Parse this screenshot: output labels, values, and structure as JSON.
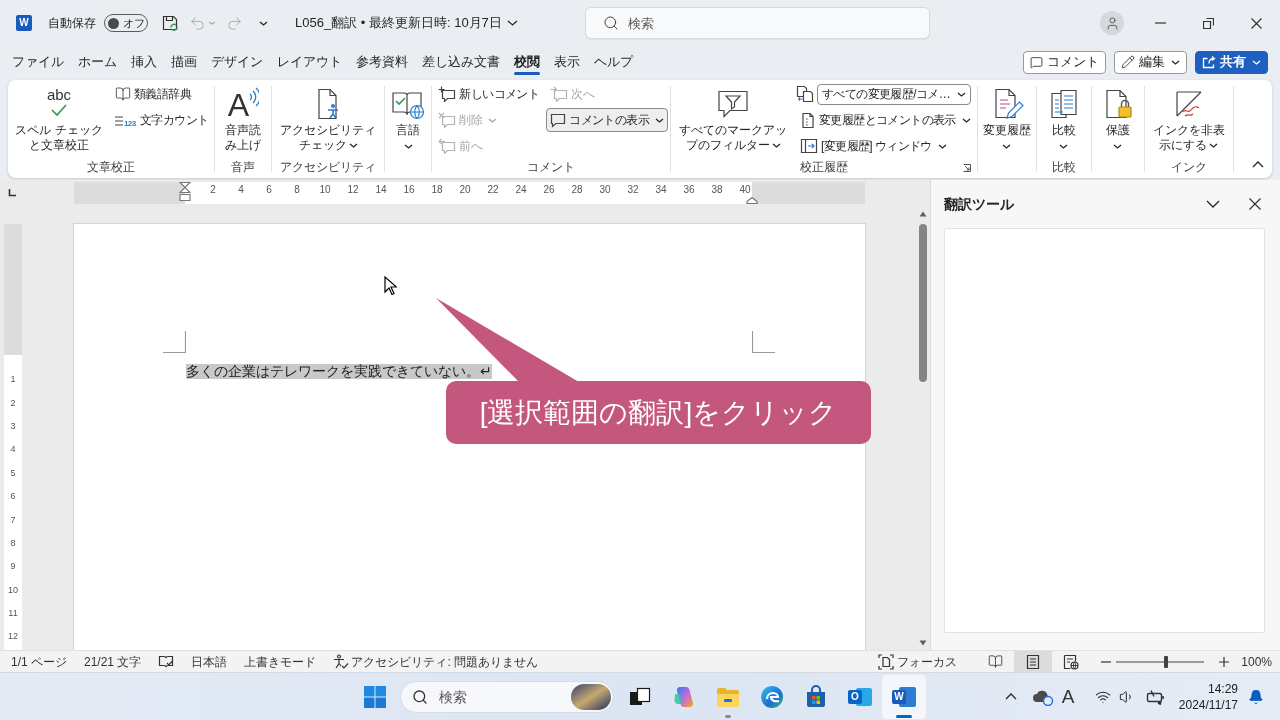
{
  "title_bar": {
    "app_letter": "W",
    "autosave": {
      "label": "自動保存",
      "state_label": "オフ",
      "on": false
    },
    "quick_access": [
      {
        "kind": "save",
        "disabled": false,
        "dropdown": false
      },
      {
        "kind": "undo",
        "disabled": true,
        "dropdown": true
      },
      {
        "kind": "redo",
        "disabled": true,
        "dropdown": false
      }
    ],
    "document_title": "L056_翻訳 • 最終更新日時: 10月7日",
    "search": {
      "placeholder": "検索"
    }
  },
  "menu_tabs": [
    {
      "label": "ファイル",
      "selected": false
    },
    {
      "label": "ホーム",
      "selected": false
    },
    {
      "label": "挿入",
      "selected": false
    },
    {
      "label": "描画",
      "selected": false
    },
    {
      "label": "デザイン",
      "selected": false
    },
    {
      "label": "レイアウト",
      "selected": false
    },
    {
      "label": "参考資料",
      "selected": false
    },
    {
      "label": "差し込み文書",
      "selected": false
    },
    {
      "label": "校閲",
      "selected": true
    },
    {
      "label": "表示",
      "selected": false
    },
    {
      "label": "ヘルプ",
      "selected": false
    }
  ],
  "tab_actions": [
    {
      "label": "コメント",
      "kind": "outline"
    },
    {
      "label": "編集",
      "kind": "menu"
    },
    {
      "label": "共有",
      "kind": "primary"
    }
  ],
  "ribbon": {
    "groups": [
      {
        "label": "文章校正",
        "columns": [
          {
            "items": [
              {
                "kind": "large",
                "icon_text": "abc",
                "label": "スペル チェックと文章校正",
                "dropdown": false
              }
            ]
          },
          {
            "items": [
              {
                "kind": "small",
                "label": "類義語辞典",
                "dropdown": false
              },
              {
                "kind": "small",
                "icon_text": "123",
                "label": "文字カウント",
                "dropdown": false
              }
            ]
          }
        ]
      },
      {
        "label": "音声",
        "columns": [
          {
            "items": [
              {
                "kind": "large",
                "icon_text": "A",
                "label": "音声読み上げ",
                "dropdown": false
              }
            ]
          }
        ]
      },
      {
        "label": "アクセシビリティ",
        "columns": [
          {
            "items": [
              {
                "kind": "large",
                "label": "アクセシビリティチェック",
                "dropdown": true
              }
            ]
          }
        ]
      },
      {
        "columns": [
          {
            "items": [
              {
                "kind": "large",
                "label": "言語",
                "dropdown": true
              }
            ]
          }
        ]
      },
      {
        "label": "コメント",
        "columns": [
          {
            "items": [
              {
                "kind": "small",
                "label": "新しいコメント",
                "dropdown": false,
                "disabled": false,
                "pressed": false
              },
              {
                "kind": "small",
                "label": "削除",
                "dropdown": true,
                "disabled": true,
                "pressed": false
              },
              {
                "kind": "small",
                "label": "前へ",
                "dropdown": false,
                "disabled": true,
                "pressed": false
              }
            ]
          },
          {
            "items": [
              {
                "kind": "small",
                "label": "次へ",
                "dropdown": false,
                "disabled": true,
                "pressed": false
              },
              {
                "kind": "small",
                "label": "コメントの表示",
                "dropdown": true,
                "disabled": false,
                "pressed": true
              }
            ]
          }
        ]
      },
      {
        "label": "校正履歴",
        "dialog_launcher": true,
        "columns": [
          {
            "items": [
              {
                "kind": "large",
                "label": "すべてのマークアップのフィルター",
                "dropdown": true
              }
            ]
          },
          {
            "items": [
              {
                "kind": "select",
                "value": "すべての変更履歴/コメ…"
              },
              {
                "kind": "small",
                "label": "変更履歴とコメントの表示",
                "dropdown": true
              },
              {
                "kind": "small",
                "label": "[変更履歴] ウィンドウ",
                "dropdown": true
              }
            ]
          }
        ]
      },
      {
        "columns": [
          {
            "items": [
              {
                "kind": "large",
                "label": "変更履歴",
                "dropdown": true
              }
            ]
          }
        ]
      },
      {
        "label": "比較",
        "columns": [
          {
            "items": [
              {
                "kind": "large",
                "label": "比較",
                "dropdown": true
              }
            ]
          }
        ]
      },
      {
        "columns": [
          {
            "items": [
              {
                "kind": "large",
                "label": "保護",
                "dropdown": true
              }
            ]
          }
        ]
      },
      {
        "label": "インク",
        "columns": [
          {
            "items": [
              {
                "kind": "large",
                "label": "インクを非表示にする",
                "dropdown": true
              }
            ]
          }
        ]
      }
    ]
  },
  "ruler": {
    "marks": [
      "2",
      "4",
      "6",
      "8",
      "10",
      "12",
      "14",
      "16",
      "18",
      "20",
      "22",
      "24",
      "26",
      "28",
      "30",
      "32",
      "34",
      "36",
      "38",
      "40"
    ]
  },
  "vertical_ruler": {
    "marks": [
      "1",
      "2",
      "3",
      "4",
      "5",
      "6",
      "7",
      "8",
      "9",
      "10",
      "11",
      "12"
    ]
  },
  "document": {
    "paragraphs": [
      {
        "text": "多くの企業はテレワークを実践できていない。↵",
        "selected": true
      }
    ]
  },
  "callout": {
    "text": "[選択範囲の翻訳]をクリック"
  },
  "side_pane": {
    "title": "翻訳ツール"
  },
  "status_bar": {
    "left": [
      {
        "kind": "text",
        "label": "1/1 ページ"
      },
      {
        "kind": "text",
        "label": "21/21 文字"
      },
      {
        "kind": "icon"
      },
      {
        "kind": "text",
        "label": "日本語"
      },
      {
        "kind": "text",
        "label": "上書きモード"
      },
      {
        "kind": "icon_text",
        "label": "アクセシビリティ: 問題ありません"
      }
    ],
    "focus": {
      "label": "フォーカス"
    },
    "views": [
      {
        "selected": false
      },
      {
        "selected": true
      },
      {
        "selected": false
      }
    ],
    "zoom": {
      "level": 0.57,
      "label": "100%"
    }
  },
  "taskbar": {
    "search": {
      "placeholder": "検索"
    },
    "apps": [
      {
        "kind": "taskview",
        "running": false,
        "active": false
      },
      {
        "kind": "copilot",
        "running": false,
        "active": false
      },
      {
        "kind": "explorer",
        "running": true,
        "active": false
      },
      {
        "kind": "edge",
        "running": false,
        "active": false
      },
      {
        "kind": "store",
        "running": false,
        "active": false
      },
      {
        "kind": "outlook",
        "letter": "O",
        "running": false,
        "active": false
      },
      {
        "kind": "word",
        "letter": "W",
        "running": true,
        "active": true
      }
    ],
    "tray": {
      "ime": "A",
      "time": "14:29",
      "date": "2024/11/17"
    }
  }
}
